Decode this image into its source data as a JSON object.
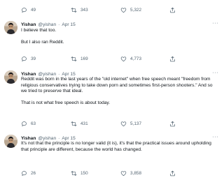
{
  "author": {
    "name": "Yishan",
    "handle": "@yishan",
    "dot": "·",
    "date": "Apr 15"
  },
  "more_label": "···",
  "top_actions": {
    "replies": "49",
    "retweets": "343",
    "likes": "5,322"
  },
  "tweets": [
    {
      "paragraphs": [
        "I believe that too.",
        "But I also ran Reddit."
      ],
      "replies": "39",
      "retweets": "169",
      "likes": "4,773"
    },
    {
      "paragraphs": [
        "Reddit was born in the last years of the \"old internet\" when free speech meant \"freedom from religious conservatives trying to take down porn and sometimes first-person shooters.\" And so we tried to preserve that ideal.",
        "That is not what free speech is about today."
      ],
      "replies": "63",
      "retweets": "431",
      "likes": "5,137"
    },
    {
      "paragraphs": [
        "It's not that the principle is no longer valid (it is), it's that the practical issues around upholding that principle are different, because the world has changed."
      ],
      "replies": "26",
      "retweets": "150",
      "likes": "3,858"
    }
  ],
  "colors": {
    "text": "#0f1419",
    "secondary": "#536471",
    "divider": "#eff3f4"
  },
  "icons": [
    "reply-icon",
    "retweet-icon",
    "like-icon",
    "share-icon",
    "more-icon"
  ]
}
